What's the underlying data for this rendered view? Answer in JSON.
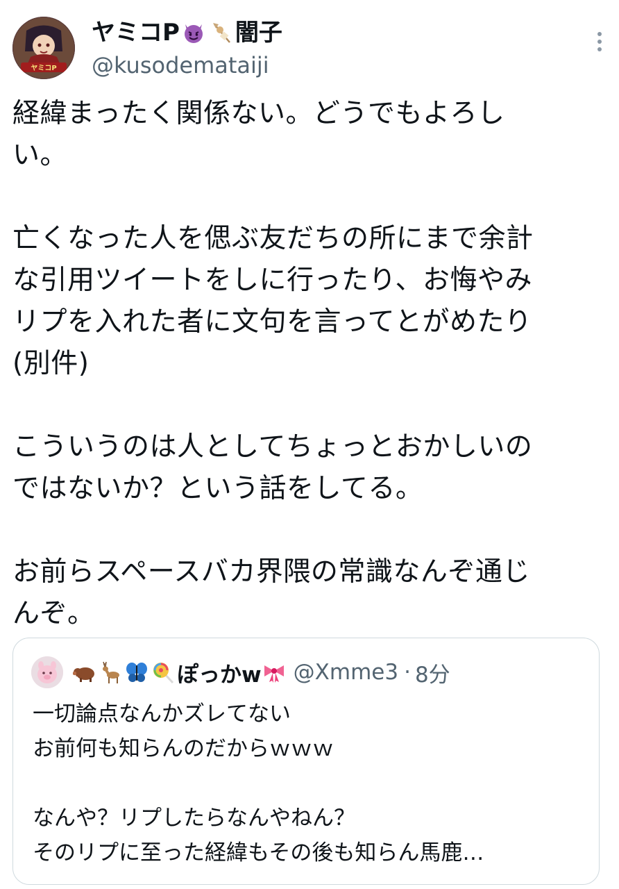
{
  "author": {
    "display_name_prefix": "ヤミコP",
    "display_name_suffix": "闇子",
    "handle": "@kusodemataiji",
    "avatar_badge": "ヤミコP",
    "name_icons": [
      "smiling-devil-emoji",
      "oden-emoji"
    ]
  },
  "tweet": {
    "paragraphs": [
      "経緯まったく関係ない。どうでもよろし\nい。",
      "亡くなった人を偲ぶ友だちの所にまで余計\nな引用ツイートをしに行ったり、お悔やみ\nリプを入れた者に文句を言ってとがめたり\n(別件)",
      "こういうのは人としてちょっとおかしいの\nではないか？という話をしてる。",
      "お前らスペースバカ界隈の常識なんぞ通じ\nんぞ。"
    ]
  },
  "quoted_tweet": {
    "display_name": "ぽっかw",
    "handle": "@Xmme3",
    "separator": "·",
    "time": "8分",
    "name_icons": [
      "boar-emoji",
      "deer-emoji",
      "butterfly-emoji",
      "lollipop-emoji",
      "ribbon-emoji"
    ],
    "paragraphs": [
      "一切論点なんかズレてない\nお前何も知らんのだからｗｗｗ",
      "なんや？リプしたらなんやねん？\nそのリプに至った経緯もその後も知らん馬鹿…"
    ]
  },
  "colors": {
    "text": "#0f1419",
    "secondary": "#536471",
    "border": "#cfd9de",
    "devil": "#8e44ad"
  }
}
